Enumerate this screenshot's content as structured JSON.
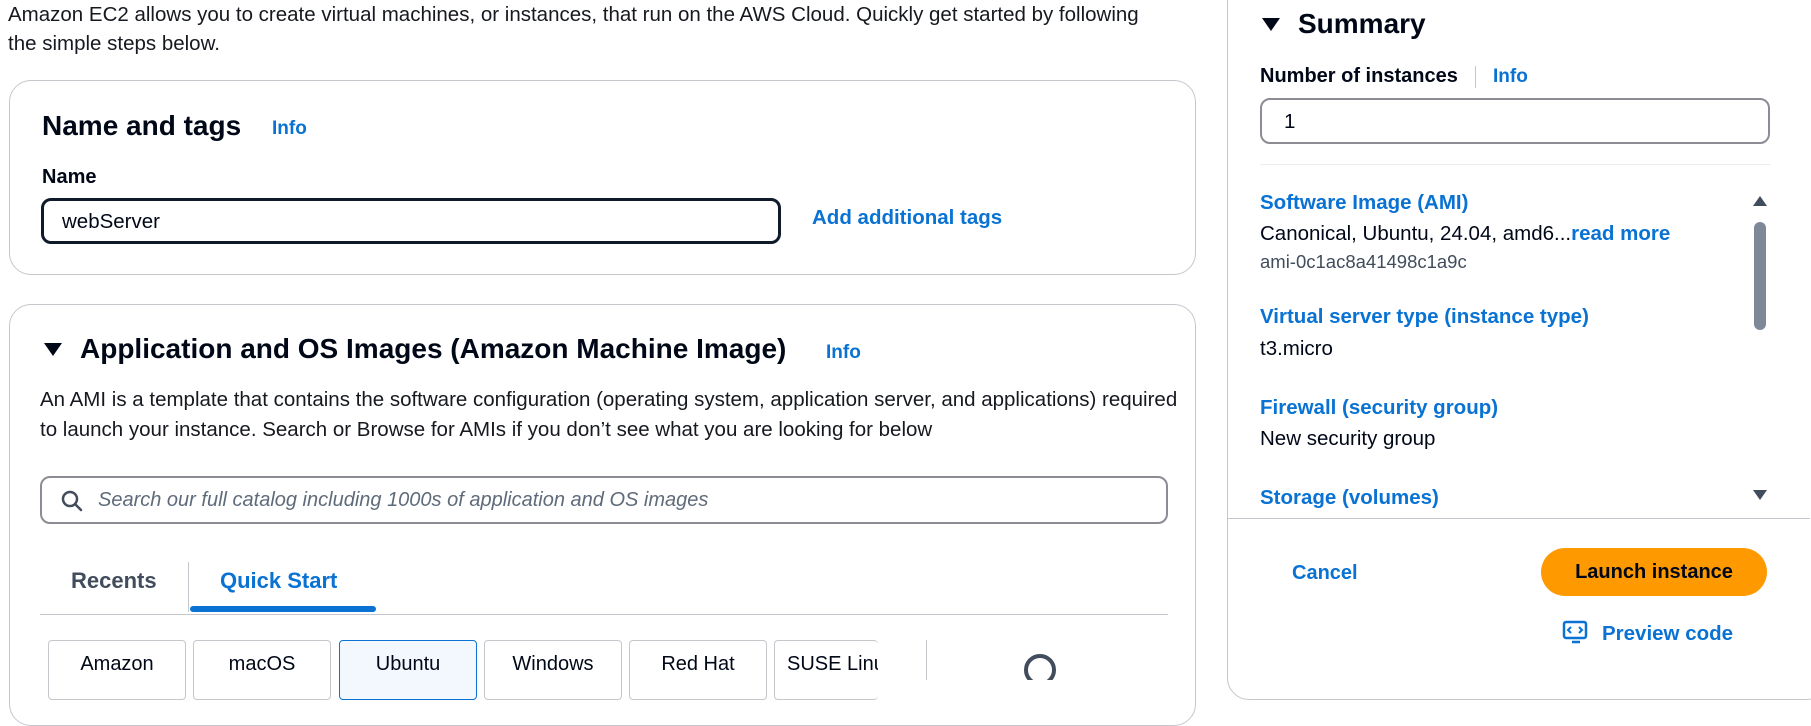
{
  "intro_text": "Amazon EC2 allows you to create virtual machines, or instances, that run on the AWS Cloud. Quickly get started by following the simple steps below.",
  "name_tags": {
    "title": "Name and tags",
    "info": "Info",
    "name_label": "Name",
    "name_value": "webServer",
    "add_tags": "Add additional tags"
  },
  "ami": {
    "title": "Application and OS Images (Amazon Machine Image)",
    "info": "Info",
    "description": "An AMI is a template that contains the software configuration (operating system, application server, and applications) required to launch your instance. Search or Browse for AMIs if you don’t see what you are looking for below",
    "search_placeholder": "Search our full catalog including 1000s of application and OS images",
    "tabs": [
      "Recents",
      "Quick Start"
    ],
    "active_tab": "Quick Start",
    "os_tiles": [
      "Amazon",
      "macOS",
      "Ubuntu",
      "Windows",
      "Red Hat",
      "SUSE Linu"
    ],
    "selected_os": "Ubuntu"
  },
  "summary": {
    "title": "Summary",
    "instances_label": "Number of instances",
    "info": "Info",
    "instances_value": "1",
    "ami_label": "Software Image (AMI)",
    "ami_value": "Canonical, Ubuntu, 24.04, amd6...",
    "read_more": "read more",
    "ami_id": "ami-0c1ac8a41498c1a9c",
    "instance_type_label": "Virtual server type (instance type)",
    "instance_type_value": "t3.micro",
    "firewall_label": "Firewall (security group)",
    "firewall_value": "New security group",
    "storage_label": "Storage (volumes)",
    "cancel": "Cancel",
    "launch": "Launch instance",
    "preview_code": "Preview code"
  },
  "colors": {
    "link": "#0972d3",
    "primary": "#ff9900",
    "text": "#000716",
    "border": "#c6c6cd"
  }
}
